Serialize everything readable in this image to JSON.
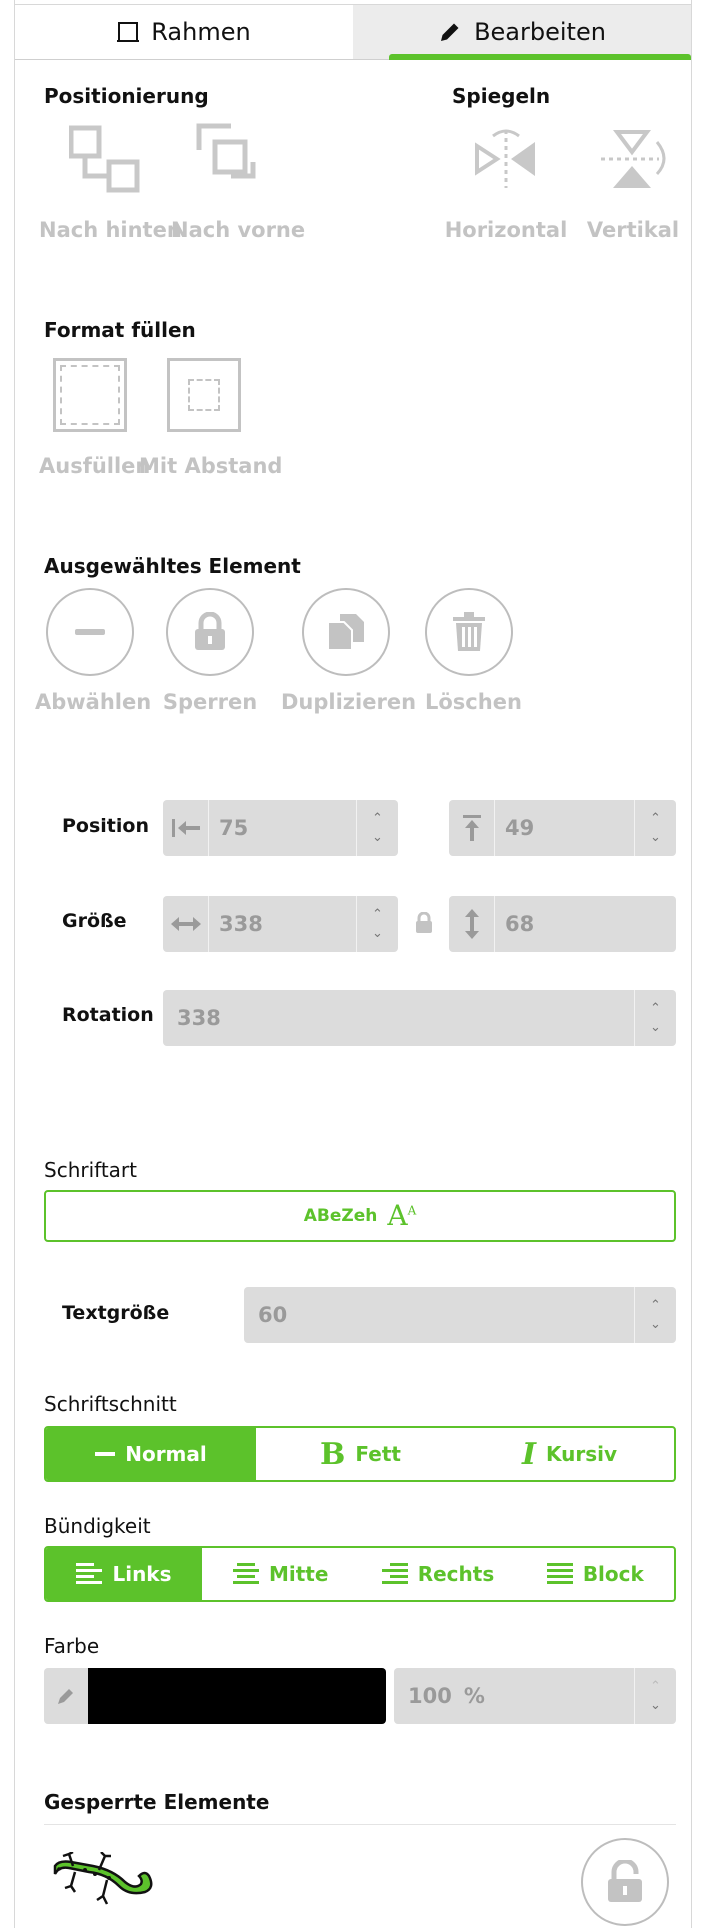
{
  "tabs": {
    "rahmen": "Rahmen",
    "bearbeiten": "Bearbeiten"
  },
  "positioning": {
    "title": "Positionierung",
    "back": "Nach hinten",
    "front": "Nach vorne"
  },
  "mirror": {
    "title": "Spiegeln",
    "horizontal": "Horizontal",
    "vertical": "Vertikal"
  },
  "fill": {
    "title": "Format füllen",
    "fill": "Ausfüllen",
    "spacing": "Mit Abstand"
  },
  "selected": {
    "title": "Ausgewähltes Element",
    "deselect": "Abwählen",
    "lock": "Sperren",
    "duplicate": "Duplizieren",
    "delete": "Löschen"
  },
  "geometry": {
    "position_label": "Position",
    "x": "75",
    "y": "49",
    "size_label": "Größe",
    "width": "338",
    "height": "68",
    "rotation_label": "Rotation",
    "rotation": "338"
  },
  "font": {
    "title": "Schriftart",
    "name": "ABeZeh",
    "size_label": "Textgröße",
    "size": "60"
  },
  "style": {
    "title": "Schriftschnitt",
    "normal": "Normal",
    "bold": "Fett",
    "italic": "Kursiv",
    "bold_glyph": "B",
    "italic_glyph": "I",
    "selected": "Normal"
  },
  "align": {
    "title": "Bündigkeit",
    "left": "Links",
    "center": "Mitte",
    "right": "Rechts",
    "block": "Block",
    "selected": "Links"
  },
  "color": {
    "title": "Farbe",
    "value": "#000000",
    "opacity": "100",
    "unit": "%"
  },
  "locked": {
    "title": "Gesperrte Elemente"
  },
  "colors": {
    "accent": "#5cc22b",
    "disabled": "#c3c3c3",
    "field": "#dcdcdc"
  }
}
